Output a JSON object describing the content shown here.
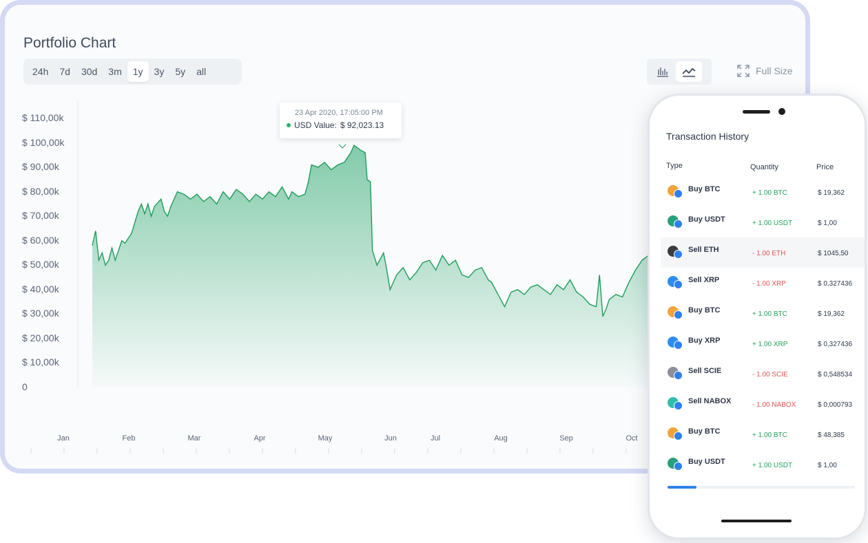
{
  "tablet": {
    "title": "Portfolio Chart",
    "ranges": [
      "24h",
      "7d",
      "30d",
      "3m",
      "1y",
      "3y",
      "5y",
      "all"
    ],
    "active_range": "1y",
    "fullsize_label": "Full Size",
    "icons": {
      "bar": "bar-chart-icon",
      "line": "line-chart-icon",
      "expand": "expand-icon"
    }
  },
  "chart_data": {
    "type": "area",
    "title": "",
    "y_ticks": [
      "$ 110,00k",
      "$ 100,00k",
      "$ 90,00k",
      "$ 80,00k",
      "$ 70,00k",
      "$ 60,00k",
      "$ 50,00k",
      "$ 40,00k",
      "$ 30,00k",
      "$ 20,00k",
      "$ 10,00k",
      "0"
    ],
    "x_ticks": [
      "Jan",
      "Feb",
      "Mar",
      "Apr",
      "May",
      "Jun",
      "Jul",
      "Aug",
      "Sep",
      "Oct"
    ],
    "ylim": [
      0,
      110000
    ],
    "series": [
      {
        "values": [
          [
            0.0,
            58000
          ],
          [
            0.05,
            64000
          ],
          [
            0.1,
            52000
          ],
          [
            0.15,
            55000
          ],
          [
            0.2,
            50000
          ],
          [
            0.25,
            52000
          ],
          [
            0.3,
            57000
          ],
          [
            0.35,
            52000
          ],
          [
            0.4,
            56000
          ],
          [
            0.45,
            60000
          ],
          [
            0.5,
            59000
          ],
          [
            0.6,
            63000
          ],
          [
            0.7,
            72000
          ],
          [
            0.75,
            75000
          ],
          [
            0.8,
            71000
          ],
          [
            0.85,
            75000
          ],
          [
            0.9,
            70000
          ],
          [
            0.95,
            74000
          ],
          [
            1.05,
            77000
          ],
          [
            1.1,
            72000
          ],
          [
            1.15,
            70000
          ],
          [
            1.2,
            74000
          ],
          [
            1.3,
            80000
          ],
          [
            1.4,
            79000
          ],
          [
            1.5,
            77000
          ],
          [
            1.6,
            79000
          ],
          [
            1.7,
            76000
          ],
          [
            1.8,
            78000
          ],
          [
            1.9,
            75000
          ],
          [
            2.0,
            80000
          ],
          [
            2.1,
            77000
          ],
          [
            2.2,
            81000
          ],
          [
            2.3,
            79000
          ],
          [
            2.4,
            76000
          ],
          [
            2.5,
            79000
          ],
          [
            2.6,
            77000
          ],
          [
            2.7,
            80000
          ],
          [
            2.8,
            78000
          ],
          [
            2.9,
            82000
          ],
          [
            3.0,
            77000
          ],
          [
            3.05,
            80000
          ],
          [
            3.15,
            78000
          ],
          [
            3.25,
            79000
          ],
          [
            3.3,
            84000
          ],
          [
            3.35,
            91000
          ],
          [
            3.45,
            90000
          ],
          [
            3.55,
            92000
          ],
          [
            3.65,
            89000
          ],
          [
            3.75,
            91000
          ],
          [
            3.85,
            92023
          ],
          [
            3.95,
            96000
          ],
          [
            4.0,
            99000
          ],
          [
            4.1,
            97000
          ],
          [
            4.17,
            96000
          ],
          [
            4.2,
            85000
          ],
          [
            4.25,
            84000
          ],
          [
            4.28,
            56000
          ],
          [
            4.35,
            50000
          ],
          [
            4.45,
            55000
          ],
          [
            4.5,
            48000
          ],
          [
            4.55,
            40000
          ],
          [
            4.65,
            46000
          ],
          [
            4.75,
            49000
          ],
          [
            4.85,
            44000
          ],
          [
            4.95,
            47000
          ],
          [
            5.05,
            51000
          ],
          [
            5.15,
            52000
          ],
          [
            5.25,
            48000
          ],
          [
            5.35,
            54000
          ],
          [
            5.45,
            50000
          ],
          [
            5.55,
            52000
          ],
          [
            5.65,
            46000
          ],
          [
            5.75,
            45000
          ],
          [
            5.85,
            48000
          ],
          [
            5.95,
            49000
          ],
          [
            6.05,
            44000
          ],
          [
            6.1,
            43000
          ],
          [
            6.2,
            38000
          ],
          [
            6.3,
            33000
          ],
          [
            6.4,
            39000
          ],
          [
            6.5,
            40000
          ],
          [
            6.6,
            38000
          ],
          [
            6.7,
            41000
          ],
          [
            6.8,
            42000
          ],
          [
            6.9,
            40000
          ],
          [
            7.0,
            38000
          ],
          [
            7.1,
            42000
          ],
          [
            7.2,
            40000
          ],
          [
            7.3,
            44000
          ],
          [
            7.4,
            39000
          ],
          [
            7.5,
            37000
          ],
          [
            7.6,
            34000
          ],
          [
            7.7,
            33000
          ],
          [
            7.75,
            46000
          ],
          [
            7.8,
            29000
          ],
          [
            7.85,
            32000
          ],
          [
            7.9,
            36000
          ],
          [
            8.0,
            38000
          ],
          [
            8.1,
            37000
          ],
          [
            8.2,
            43000
          ],
          [
            8.3,
            48000
          ],
          [
            8.4,
            52000
          ],
          [
            8.5,
            54000
          ],
          [
            8.6,
            51000
          ],
          [
            8.7,
            55000
          ],
          [
            8.8,
            58000
          ],
          [
            8.9,
            62000
          ],
          [
            9.0,
            58000
          ],
          [
            9.05,
            56000
          ]
        ]
      }
    ],
    "tooltip": {
      "date": "23 Apr 2020, 17:05:00 PM",
      "label": "USD Value:",
      "value": "$ 92,023.13"
    },
    "line_color": "#1f9d5a",
    "fill_color": "#21a366"
  },
  "transactions": {
    "title": "Transaction History",
    "headers": {
      "type": "Type",
      "quantity": "Quantity",
      "price": "Price"
    },
    "rows": [
      {
        "type": "Buy BTC",
        "quantity": "+ 1.00 BTC",
        "price": "$ 19,362",
        "dir": "pos",
        "coin": "#f2a33a",
        "icon": "bitcoin-icon"
      },
      {
        "type": "Buy USDT",
        "quantity": "+ 1.00 USDT",
        "price": "$ 1,00",
        "dir": "pos",
        "coin": "#26a17b",
        "icon": "tether-icon"
      },
      {
        "type": "Sell ETH",
        "quantity": "- 1.00 ETH",
        "price": "$ 1045,50",
        "dir": "neg",
        "coin": "#3c3c3d",
        "icon": "ethereum-icon"
      },
      {
        "type": "Sell XRP",
        "quantity": "- 1.00 XRP",
        "price": "$ 0,327436",
        "dir": "neg",
        "coin": "#2d8ef0",
        "icon": "ripple-icon"
      },
      {
        "type": "Buy BTC",
        "quantity": "+ 1.00 BTC",
        "price": "$ 19,362",
        "dir": "pos",
        "coin": "#f2a33a",
        "icon": "bitcoin-icon"
      },
      {
        "type": "Buy XRP",
        "quantity": "+ 1.00 XRP",
        "price": "$ 0,327436",
        "dir": "pos",
        "coin": "#2d8ef0",
        "icon": "ripple-icon"
      },
      {
        "type": "Sell SCIE",
        "quantity": "- 1.00 SCIE",
        "price": "$ 0,548534",
        "dir": "neg",
        "coin": "#8a8f98",
        "icon": "atom-icon"
      },
      {
        "type": "Sell NABOX",
        "quantity": "- 1.00 NABOX",
        "price": "$ 0,000793",
        "dir": "neg",
        "coin": "#2fbfa8",
        "icon": "nabox-icon"
      },
      {
        "type": "Buy BTC",
        "quantity": "+ 1.00 BTC",
        "price": "$ 48,385",
        "dir": "pos",
        "coin": "#f2a33a",
        "icon": "bitcoin-icon"
      },
      {
        "type": "Buy USDT",
        "quantity": "+ 1.00 USDT",
        "price": "$ 1,00",
        "dir": "pos",
        "coin": "#26a17b",
        "icon": "tether-icon"
      }
    ]
  }
}
